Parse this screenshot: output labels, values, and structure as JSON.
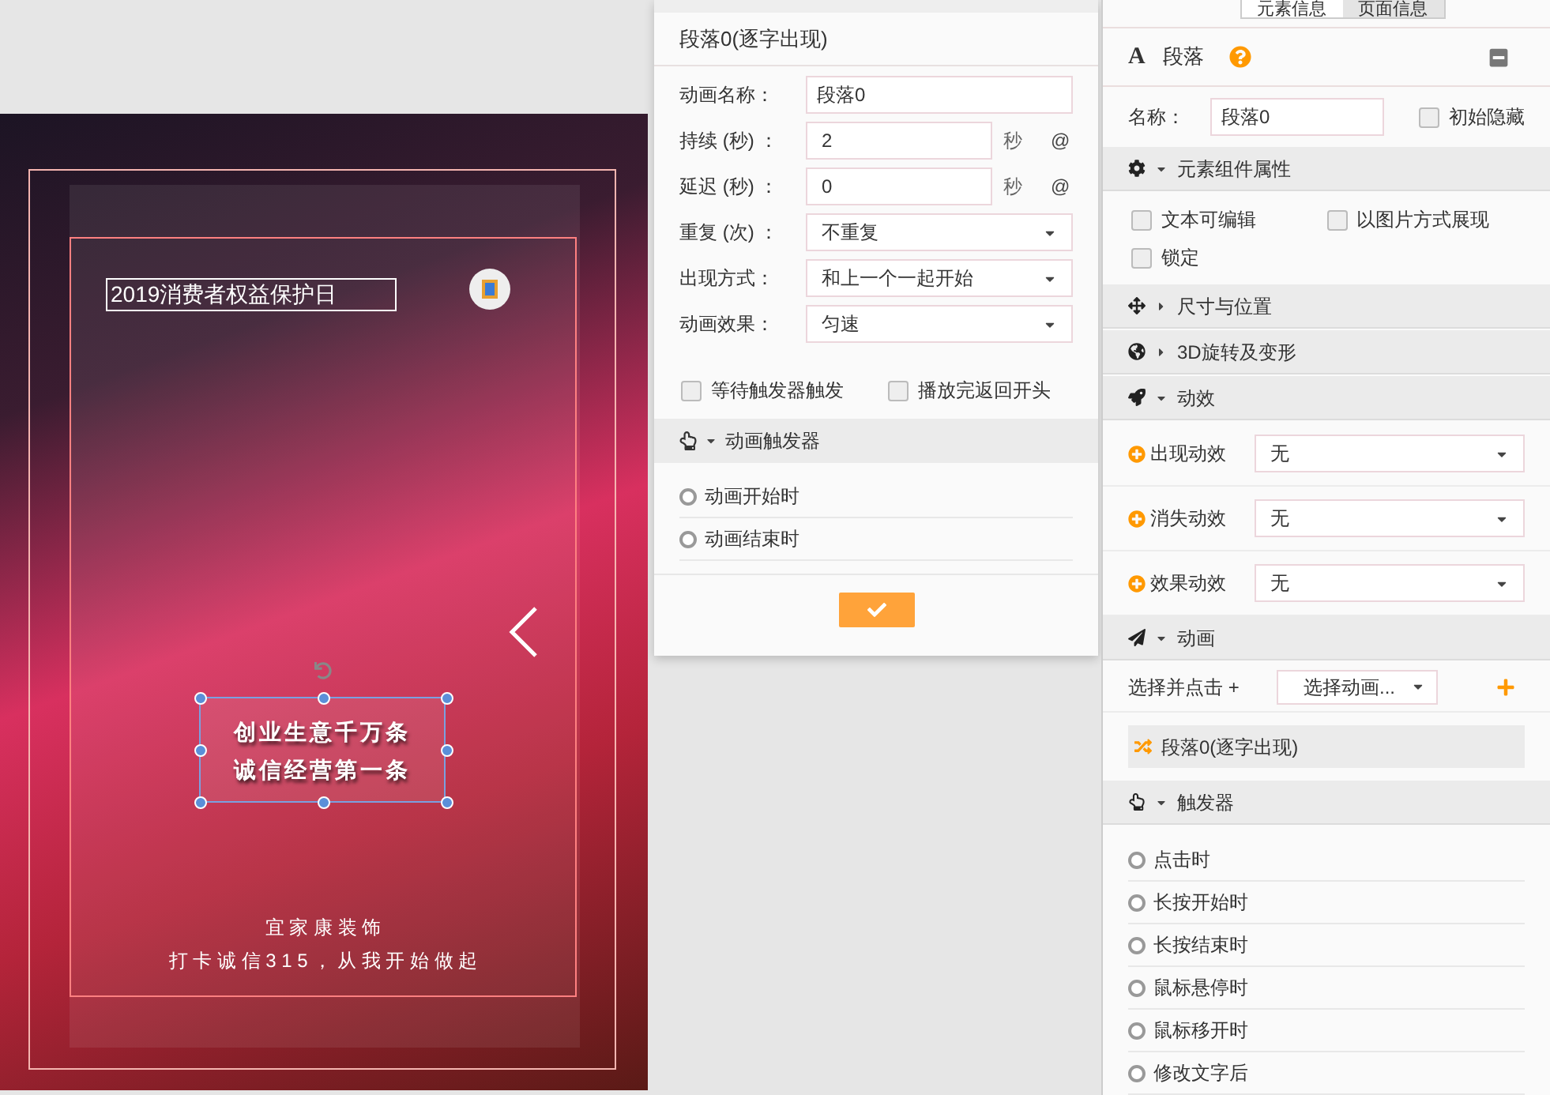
{
  "canvas": {
    "title": "2019消费者权益保护日",
    "selected_text": [
      "创业生意千万条",
      "诚信经营第一条"
    ],
    "footer": [
      "宜 家 康 装 饰",
      "打 卡 诚 信 3 1 5 ， 从 我 开 始 做 起"
    ]
  },
  "animation_dialog": {
    "title": "段落0(逐字出现)",
    "fields": [
      {
        "kind": "input",
        "label": "动画名称：",
        "value": "段落0"
      },
      {
        "kind": "number",
        "label": "持续 (秒) ：",
        "value": "2",
        "unit": "秒",
        "suffix": "@"
      },
      {
        "kind": "number",
        "label": "延迟 (秒) ：",
        "value": "0",
        "unit": "秒",
        "suffix": "@"
      },
      {
        "kind": "select",
        "label": "重复 (次) ：",
        "value": "不重复"
      },
      {
        "kind": "select",
        "label": "出现方式：",
        "value": "和上一个一起开始"
      },
      {
        "kind": "select",
        "label": "动画效果：",
        "value": "匀速"
      }
    ],
    "options": [
      {
        "label": "等待触发器触发",
        "checked": false
      },
      {
        "label": "播放完返回开头",
        "checked": false
      }
    ],
    "trigger_section": "动画触发器",
    "triggers": [
      "动画开始时",
      "动画结束时"
    ]
  },
  "properties": {
    "tabs": [
      {
        "label": "元素信息",
        "selected": true
      },
      {
        "label": "页面信息",
        "selected": false
      }
    ],
    "type_icon": "A",
    "element_type": "段落",
    "name_label": "名称：",
    "name_value": "段落0",
    "hidden": {
      "label": "初始隐藏",
      "checked": false
    },
    "sections": [
      {
        "title": "元素组件属性",
        "expanded": true,
        "checkboxes": [
          {
            "label": "文本可编辑",
            "checked": false
          },
          {
            "label": "以图片方式展现",
            "checked": false
          },
          {
            "label": "锁定",
            "checked": false
          }
        ]
      },
      {
        "title": "尺寸与位置",
        "expanded": false
      },
      {
        "title": "3D旋转及变形",
        "expanded": false
      },
      {
        "title": "动效",
        "expanded": true,
        "effects": [
          {
            "label": "出现动效",
            "value": "无"
          },
          {
            "label": "消失动效",
            "value": "无"
          },
          {
            "label": "效果动效",
            "value": "无"
          }
        ]
      },
      {
        "title": "动画",
        "expanded": true,
        "picker_label": "选择并点击 +",
        "picker_value": "选择动画...",
        "items": [
          "段落0(逐字出现)"
        ]
      },
      {
        "title": "触发器",
        "expanded": true,
        "triggers": [
          "点击时",
          "长按开始时",
          "长按结束时",
          "鼠标悬停时",
          "鼠标移开时",
          "修改文字后"
        ]
      }
    ]
  }
}
